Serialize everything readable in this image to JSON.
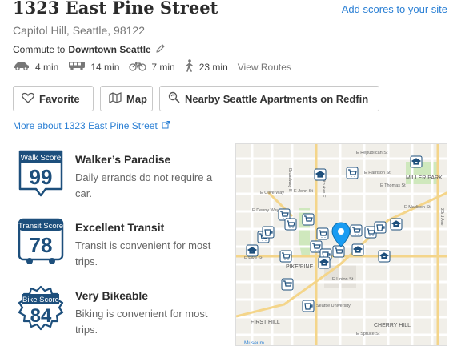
{
  "header": {
    "title": "1323 East Pine Street",
    "add_scores_link": "Add scores to your site",
    "subtitle": "Capitol Hill, Seattle, 98122"
  },
  "commute": {
    "prefix": "Commute to",
    "destination": "Downtown Seattle",
    "modes": [
      {
        "icon": "car-icon",
        "time": "4 min"
      },
      {
        "icon": "bus-icon",
        "time": "14 min"
      },
      {
        "icon": "bike-icon",
        "time": "7 min"
      },
      {
        "icon": "walk-icon",
        "time": "23 min"
      }
    ],
    "view_routes": "View Routes"
  },
  "buttons": {
    "favorite": "Favorite",
    "map": "Map",
    "nearby": "Nearby Seattle Apartments on Redfin"
  },
  "more_link": "More about 1323 East Pine Street",
  "scores": [
    {
      "badge_label": "Walk Score",
      "value": "99",
      "heading": "Walker’s Paradise",
      "description": "Daily errands do not require a car.",
      "shape": "sign"
    },
    {
      "badge_label": "Transit Score",
      "value": "78",
      "heading": "Excellent Transit",
      "description": "Transit is convenient for most trips.",
      "shape": "bus"
    },
    {
      "badge_label": "Bike Score",
      "value": "84",
      "heading": "Very Bikeable",
      "description": "Biking is convenient for most trips.",
      "shape": "gear"
    }
  ],
  "map": {
    "street_labels": [
      "E Republican St",
      "Broadway E",
      "10th Ave E",
      "E Harrison St",
      "E Thomas St",
      "E John St",
      "E Olive Way",
      "E Denny Way",
      "MILLER PARK",
      "E Madison St",
      "PIKE/PINE",
      "E Pike St",
      "E Union St",
      "FIRST HILL",
      "CHERRY HILL",
      "23rd Ave",
      "Museum",
      "Seattle University",
      "E Spruce St"
    ],
    "colors": {
      "accent": "#2a7fd4",
      "badge": "#1d4f7c",
      "marker": "#1a9cf2",
      "park": "#cfe8bd"
    }
  }
}
